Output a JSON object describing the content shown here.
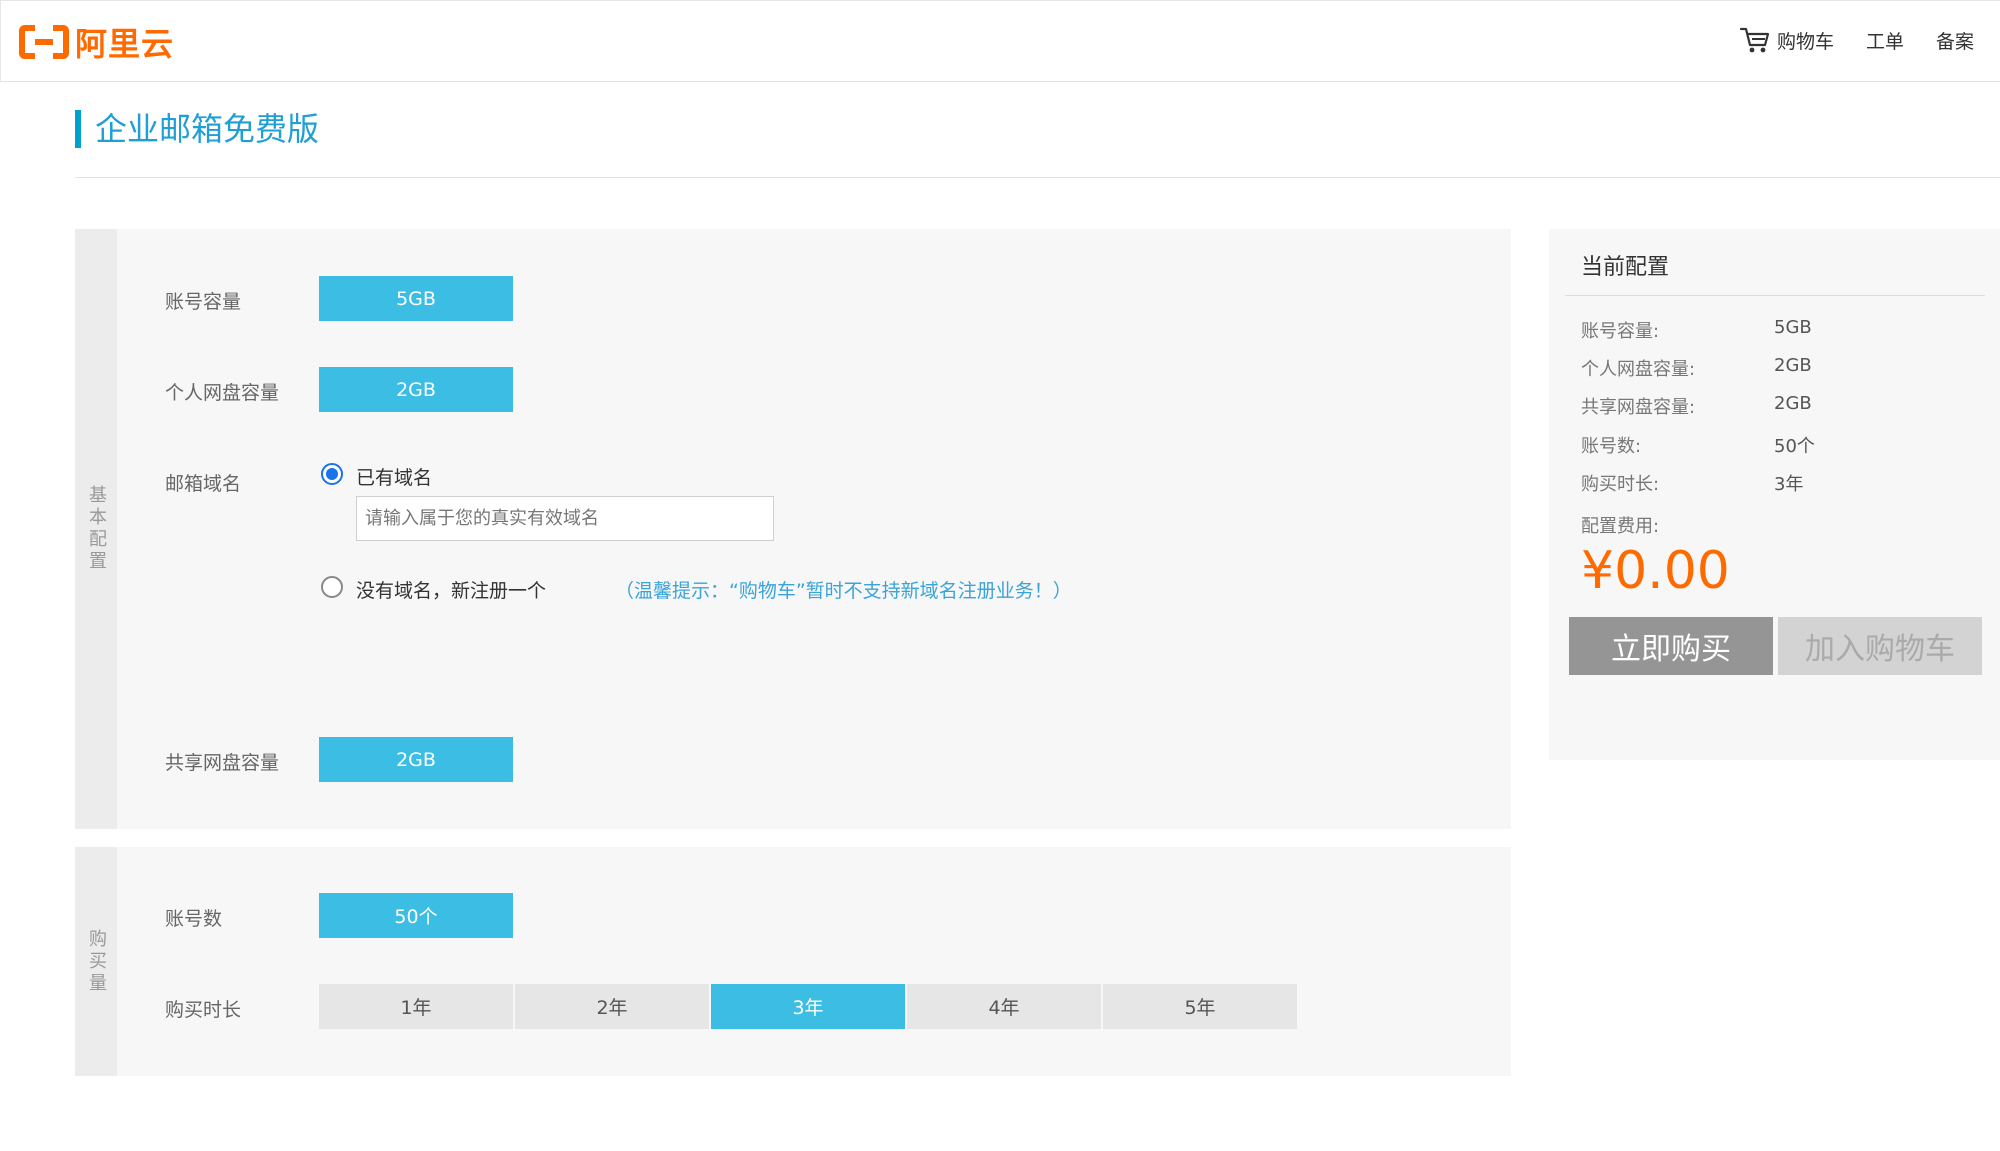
{
  "header": {
    "logo_text": "阿里云",
    "nav": {
      "cart": "购物车",
      "ticket": "工单",
      "record": "备案"
    }
  },
  "page": {
    "title": "企业邮箱免费版"
  },
  "basic_config": {
    "side_label": "基本配置",
    "account_capacity": {
      "label": "账号容量",
      "value": "5GB"
    },
    "personal_disk": {
      "label": "个人网盘容量",
      "value": "2GB"
    },
    "mail_domain": {
      "label": "邮箱域名",
      "option_has_domain": "已有域名",
      "option_has_domain_checked": true,
      "domain_input_placeholder": "请输入属于您的真实有效域名",
      "domain_input_value": "",
      "option_no_domain": "没有域名，新注册一个",
      "hint": "（温馨提示：“购物车”暂时不支持新域名注册业务！）"
    },
    "shared_disk": {
      "label": "共享网盘容量",
      "value": "2GB"
    }
  },
  "purchase": {
    "side_label": "购买量",
    "accounts": {
      "label": "账号数",
      "value": "50个"
    },
    "duration": {
      "label": "购买时长",
      "options": [
        "1年",
        "2年",
        "3年",
        "4年",
        "5年"
      ],
      "selected": "3年"
    }
  },
  "summary": {
    "title": "当前配置",
    "rows": [
      {
        "key": "账号容量:",
        "value": "5GB"
      },
      {
        "key": "个人网盘容量:",
        "value": "2GB"
      },
      {
        "key": "共享网盘容量:",
        "value": "2GB"
      },
      {
        "key": "账号数:",
        "value": "50个"
      },
      {
        "key": "购买时长:",
        "value": "3年"
      }
    ],
    "fee_label": "配置费用:",
    "price": "¥0.00",
    "buy_now": "立即购买",
    "add_to_cart": "加入购物车"
  },
  "colors": {
    "brand": "#ff6a00",
    "accent": "#3bbde4",
    "title": "#1f9fd4"
  }
}
